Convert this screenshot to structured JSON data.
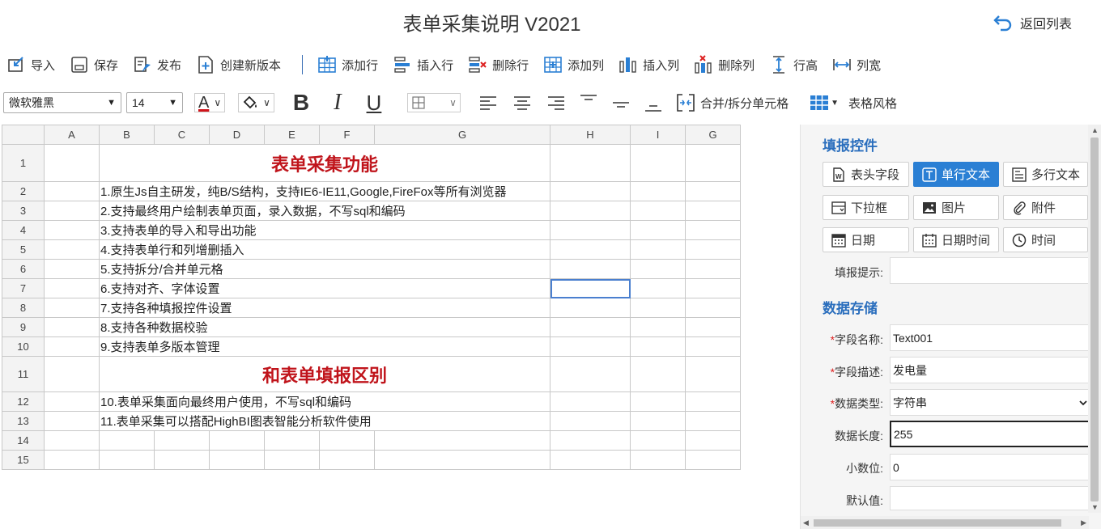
{
  "header": {
    "title": "表单采集说明  V2021",
    "back_label": "返回列表"
  },
  "toolbar": {
    "import": "导入",
    "save": "保存",
    "publish": "发布",
    "new_version": "创建新版本",
    "add_row": "添加行",
    "insert_row": "插入行",
    "delete_row": "删除行",
    "add_col": "添加列",
    "insert_col": "插入列",
    "delete_col": "删除列",
    "row_height": "行高",
    "col_width": "列宽"
  },
  "format": {
    "font_family": "微软雅黑",
    "font_size": "14",
    "font_color_letter": "A",
    "merge_label": "合并/拆分单元格",
    "table_style_label": "表格风格",
    "colors": {
      "font": "#d0141b",
      "accent": "#2a7fd4"
    }
  },
  "sheet": {
    "columns": [
      "A",
      "B",
      "C",
      "D",
      "E",
      "F",
      "G",
      "H",
      "I",
      "G"
    ],
    "rows": [
      {
        "n": "1",
        "text": "表单采集功能",
        "style": "big"
      },
      {
        "n": "2",
        "text": "1.原生Js自主研发，纯B/S结构，支持IE6-IE11,Google,FireFox等所有浏览器"
      },
      {
        "n": "3",
        "text": "2.支持最终用户绘制表单页面，录入数据，不写sql和编码"
      },
      {
        "n": "4",
        "text": "3.支持表单的导入和导出功能"
      },
      {
        "n": "5",
        "text": "4.支持表单行和列增删插入"
      },
      {
        "n": "6",
        "text": "5.支持拆分/合并单元格"
      },
      {
        "n": "7",
        "text": "6.支持对齐、字体设置"
      },
      {
        "n": "8",
        "text": "7.支持各种填报控件设置"
      },
      {
        "n": "9",
        "text": "8.支持各种数据校验"
      },
      {
        "n": "10",
        "text": "9.支持表单多版本管理"
      },
      {
        "n": "11",
        "text": "和表单填报区别",
        "style": "big"
      },
      {
        "n": "12",
        "text": "10.表单采集面向最终用户使用，不写sql和编码"
      },
      {
        "n": "13",
        "text": "11.表单采集可以搭配HighBI图表智能分析软件使用"
      },
      {
        "n": "14",
        "text": ""
      },
      {
        "n": "15",
        "text": ""
      }
    ]
  },
  "panel": {
    "controls_title": "填报控件",
    "controls": {
      "header_field": "表头字段",
      "single_text": "单行文本",
      "multi_text": "多行文本",
      "dropdown": "下拉框",
      "image": "图片",
      "attachment": "附件",
      "date": "日期",
      "datetime": "日期时间",
      "time": "时间"
    },
    "hint_label": "填报提示:",
    "storage_title": "数据存储",
    "field_name_label": "字段名称:",
    "field_name_value": "Text001",
    "field_desc_label": "字段描述:",
    "field_desc_value": "发电量",
    "data_type_label": "数据类型:",
    "data_type_value": "字符串",
    "data_length_label": "数据长度:",
    "data_length_value": "255",
    "decimal_label": "小数位:",
    "decimal_value": "0",
    "default_label": "默认值:",
    "default_value": "",
    "required_mark": "*"
  }
}
